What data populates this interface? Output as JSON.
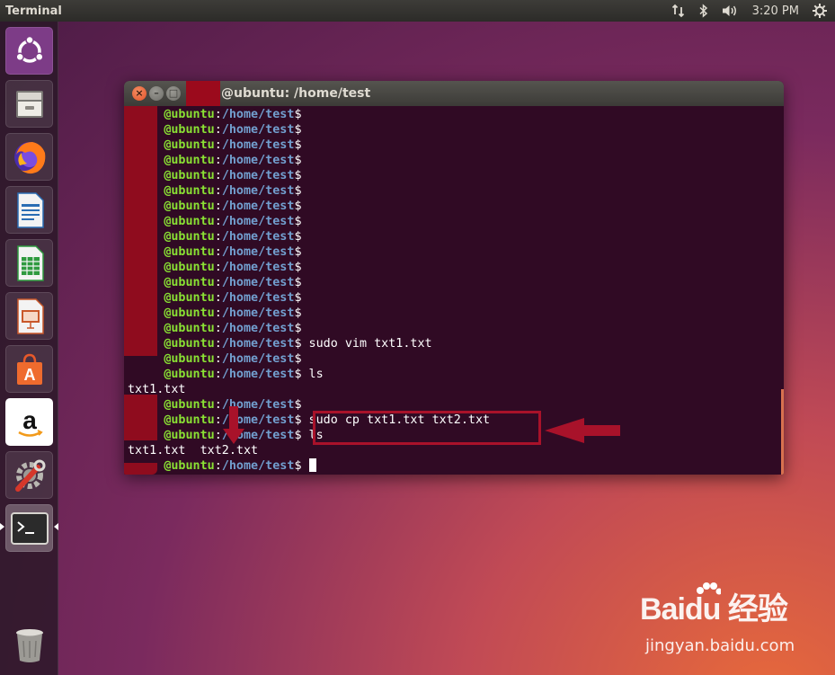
{
  "top_panel": {
    "app_title": "Terminal",
    "clock": "3:20 PM"
  },
  "launcher": {
    "items": [
      {
        "name": "Dash Home",
        "icon": "ubuntu-logo-icon"
      },
      {
        "name": "Files",
        "icon": "files-drawer-icon"
      },
      {
        "name": "Firefox Web Browser",
        "icon": "firefox-icon"
      },
      {
        "name": "LibreOffice Writer",
        "icon": "writer-document-icon"
      },
      {
        "name": "LibreOffice Calc",
        "icon": "calc-spreadsheet-icon"
      },
      {
        "name": "LibreOffice Impress",
        "icon": "impress-presentation-icon"
      },
      {
        "name": "Ubuntu Software",
        "icon": "software-center-bag-icon"
      },
      {
        "name": "Amazon",
        "icon": "amazon-icon"
      },
      {
        "name": "System Settings",
        "icon": "settings-wrench-icon"
      },
      {
        "name": "Terminal",
        "icon": "terminal-icon",
        "active": true
      },
      {
        "name": "Trash",
        "icon": "trash-icon"
      }
    ]
  },
  "terminal": {
    "window_title": "@ubuntu: /home/test",
    "prompt_user": "@ubuntu",
    "prompt_colon": ":",
    "prompt_path": "/home/test",
    "prompt_dollar": "$",
    "lines": [
      {
        "type": "prompt",
        "cmd": ""
      },
      {
        "type": "prompt",
        "cmd": ""
      },
      {
        "type": "prompt",
        "cmd": ""
      },
      {
        "type": "prompt",
        "cmd": ""
      },
      {
        "type": "prompt",
        "cmd": ""
      },
      {
        "type": "prompt",
        "cmd": ""
      },
      {
        "type": "prompt",
        "cmd": ""
      },
      {
        "type": "prompt",
        "cmd": ""
      },
      {
        "type": "prompt",
        "cmd": ""
      },
      {
        "type": "prompt",
        "cmd": ""
      },
      {
        "type": "prompt",
        "cmd": ""
      },
      {
        "type": "prompt",
        "cmd": ""
      },
      {
        "type": "prompt",
        "cmd": ""
      },
      {
        "type": "prompt",
        "cmd": ""
      },
      {
        "type": "prompt",
        "cmd": ""
      },
      {
        "type": "prompt",
        "cmd": " sudo vim txt1.txt"
      },
      {
        "type": "prompt",
        "cmd": ""
      },
      {
        "type": "prompt",
        "cmd": " ls"
      },
      {
        "type": "output",
        "text": "txt1.txt"
      },
      {
        "type": "prompt",
        "cmd": ""
      },
      {
        "type": "prompt",
        "cmd": " sudo cp txt1.txt txt2.txt"
      },
      {
        "type": "prompt",
        "cmd": " ls"
      },
      {
        "type": "output",
        "text": "txt1.txt  txt2.txt"
      },
      {
        "type": "prompt",
        "cmd": " ",
        "cursor": true
      }
    ]
  },
  "watermark": {
    "brand": "Baidu 经验",
    "site": "jingyan.baidu.com"
  },
  "colors": {
    "terminal_bg": "#300a24",
    "prompt_user": "#8ae234",
    "prompt_path": "#729fcf",
    "annotation": "#a8122a"
  }
}
